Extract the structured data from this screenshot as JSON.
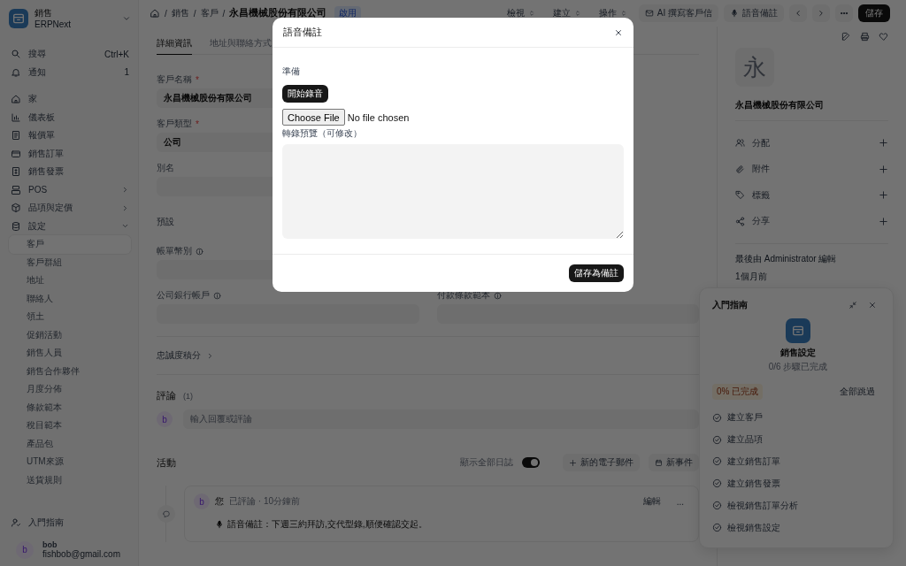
{
  "sidebar": {
    "app": {
      "title": "銷售",
      "subtitle": "ERPNext"
    },
    "search": {
      "label": "搜尋",
      "shortcut": "Ctrl+K"
    },
    "notifications": {
      "label": "通知",
      "count": "1"
    },
    "items": [
      {
        "label": "家"
      },
      {
        "label": "儀表板"
      },
      {
        "label": "報價單"
      },
      {
        "label": "銷售訂單"
      },
      {
        "label": "銷售發票"
      },
      {
        "label": "POS",
        "expanded": false
      },
      {
        "label": "品項與定價",
        "expanded": false
      },
      {
        "label": "設定",
        "expanded": true,
        "children": [
          {
            "label": "客戶",
            "selected": true
          },
          {
            "label": "客戶群組",
            "selected": false
          },
          {
            "label": "地址",
            "selected": false
          },
          {
            "label": "聯絡人",
            "selected": false
          },
          {
            "label": "領土",
            "selected": false
          },
          {
            "label": "促銷活動",
            "selected": false
          },
          {
            "label": "銷售人員",
            "selected": false
          },
          {
            "label": "銷售合作夥伴",
            "selected": false
          },
          {
            "label": "月度分佈",
            "selected": false
          },
          {
            "label": "條款範本",
            "selected": false
          },
          {
            "label": "稅目範本",
            "selected": false
          },
          {
            "label": "產品包",
            "selected": false
          },
          {
            "label": "UTM來源",
            "selected": false
          },
          {
            "label": "送貨規則",
            "selected": false
          }
        ]
      }
    ],
    "guide": "入門指南",
    "user": {
      "initial": "b",
      "name": "bob",
      "email": "fishbob@gmail.com"
    }
  },
  "topbar": {
    "separator": "/",
    "breadcrumbs": [
      "銷售",
      "客戶"
    ],
    "title": "永昌機械股份有限公司",
    "status": "啟用",
    "menus": [
      "檢視",
      "建立",
      "操作"
    ],
    "actions": [
      "AI 撰寫客戶信",
      "語音備註"
    ],
    "save": "儲存"
  },
  "tabs": [
    {
      "label": "詳細資訊",
      "selected": true
    },
    {
      "label": "地址與聯絡方式",
      "selected": false
    }
  ],
  "form": {
    "left": [
      {
        "label": "客戶名稱",
        "mark": "*",
        "value": "永昌機械股份有限公司"
      },
      {
        "label": "客戶類型",
        "mark": "*",
        "value": "公司"
      },
      {
        "label": "別名"
      }
    ],
    "section": "預設",
    "left2": [
      {
        "label": "帳單幣別",
        "info": true
      },
      {
        "label": "公司銀行帳戶",
        "info": true
      }
    ],
    "right2": [
      {
        "label": "付款條款範本",
        "info": true
      }
    ],
    "loyalty": "忠誠度積分"
  },
  "comments": {
    "title": "評論",
    "count": "(1)",
    "avatar": "b",
    "placeholder": "輸入回覆或評論"
  },
  "activity": {
    "title": "活動",
    "toggle": {
      "label": "顯示全部日誌",
      "on": true
    },
    "buttons": [
      "新的電子郵件",
      "新事件"
    ],
    "entries": [
      {
        "avatar": "b",
        "author": "您",
        "meta": "已評論 · 10分鐘前",
        "edit": "編輯",
        "more": "...",
        "body": "語音備註：下週三約拜訪,交代型錄,順便確認交起。"
      }
    ]
  },
  "aside": {
    "avatar": "永",
    "name": "永昌機械股份有限公司",
    "items": [
      "分配",
      "附件",
      "標籤",
      "分享"
    ],
    "edited": "最後由 Administrator 編輯",
    "time": "1個月前"
  },
  "onboarding": {
    "title": "入門指南",
    "name": "銷售設定",
    "progress": "0/6 步驟已完成",
    "badge": "0% 已完成",
    "skip": "全部跳過",
    "steps": [
      {
        "label": "建立客戶",
        "done": false
      },
      {
        "label": "建立品項",
        "done": false
      },
      {
        "label": "建立銷售訂單",
        "done": false
      },
      {
        "label": "建立銷售發票",
        "done": false
      },
      {
        "label": "檢視銷售訂單分析",
        "done": false
      },
      {
        "label": "檢視銷售設定",
        "done": false
      }
    ]
  },
  "dialog": {
    "title": "語音備註",
    "status": "準備",
    "record": "開始錄音",
    "file_button": "Choose File",
    "file_status": "No file chosen",
    "preview_label": "轉錄預覽（可修改）",
    "save": "儲存為備註"
  }
}
